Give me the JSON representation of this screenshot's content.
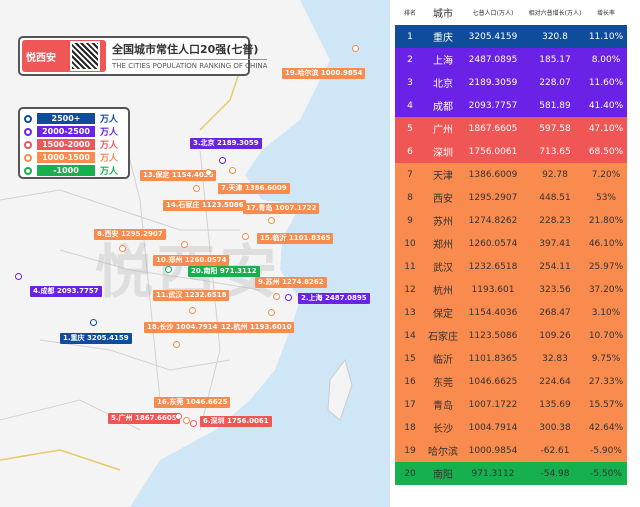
{
  "title": {
    "brand": "悦西安",
    "cn": "全国城市常住人口20强(七普)",
    "en": "THE CITIES POPULATION RANKING OF CHINA"
  },
  "watermark": "悦西安",
  "legend": [
    {
      "range": "2500+",
      "unit": "万人",
      "color": "#0f4c9c"
    },
    {
      "range": "2000-2500",
      "unit": "万人",
      "color": "#6a22e6"
    },
    {
      "range": "1500-2000",
      "unit": "万人",
      "color": "#f05656"
    },
    {
      "range": "1000-1500",
      "unit": "万人",
      "color": "#f98b4e"
    },
    {
      "range": "-1000",
      "unit": "万人",
      "color": "#17b04e"
    }
  ],
  "map_labels": [
    {
      "text": "19.哈尔滨 1000.9854",
      "tier": 3
    },
    {
      "text": "3.北京 2189.3059",
      "tier": 1
    },
    {
      "text": "13.保定 1154.4036",
      "tier": 3
    },
    {
      "text": "7.天津 1386.6009",
      "tier": 3
    },
    {
      "text": "14.石家庄 1123.5086",
      "tier": 3
    },
    {
      "text": "17.青岛 1007.1722",
      "tier": 3
    },
    {
      "text": "8.西安 1295.2907",
      "tier": 3
    },
    {
      "text": "15.临沂 1101.8365",
      "tier": 3
    },
    {
      "text": "10.郑州 1260.0574",
      "tier": 3
    },
    {
      "text": "20.南阳 971.3112",
      "tier": 4
    },
    {
      "text": "9.苏州 1274.8262",
      "tier": 3
    },
    {
      "text": "4.成都 2093.7757",
      "tier": 1
    },
    {
      "text": "2.上海 2487.0895",
      "tier": 1
    },
    {
      "text": "11.武汉 1232.6518",
      "tier": 3
    },
    {
      "text": "18.长沙 1004.7914",
      "tier": 3
    },
    {
      "text": "12.杭州 1193.6010",
      "tier": 3
    },
    {
      "text": "1.重庆 3205.4159",
      "tier": 0
    },
    {
      "text": "16.东莞 1046.6625",
      "tier": 3
    },
    {
      "text": "5.广州 1867.6605",
      "tier": 2
    },
    {
      "text": "6.深圳 1756.0061",
      "tier": 2
    }
  ],
  "chart_data": {
    "type": "table",
    "title": "全国城市常住人口20强(七普)",
    "columns": [
      "排名",
      "城市",
      "七普人口(万人)",
      "相对六普增长(万人)",
      "增长率"
    ],
    "rows": [
      [
        "1",
        "重庆",
        "3205.4159",
        "320.8",
        "11.10%"
      ],
      [
        "2",
        "上海",
        "2487.0895",
        "185.17",
        "8.00%"
      ],
      [
        "3",
        "北京",
        "2189.3059",
        "228.07",
        "11.60%"
      ],
      [
        "4",
        "成都",
        "2093.7757",
        "581.89",
        "41.40%"
      ],
      [
        "5",
        "广州",
        "1867.6605",
        "597.58",
        "47.10%"
      ],
      [
        "6",
        "深圳",
        "1756.0061",
        "713.65",
        "68.50%"
      ],
      [
        "7",
        "天津",
        "1386.6009",
        "92.78",
        "7.20%"
      ],
      [
        "8",
        "西安",
        "1295.2907",
        "448.51",
        "53%"
      ],
      [
        "9",
        "苏州",
        "1274.8262",
        "228.23",
        "21.80%"
      ],
      [
        "10",
        "郑州",
        "1260.0574",
        "397.41",
        "46.10%"
      ],
      [
        "11",
        "武汉",
        "1232.6518",
        "254.11",
        "25.97%"
      ],
      [
        "12",
        "杭州",
        "1193.601",
        "323.56",
        "37.20%"
      ],
      [
        "13",
        "保定",
        "1154.4036",
        "268.47",
        "3.10%"
      ],
      [
        "14",
        "石家庄",
        "1123.5086",
        "109.26",
        "10.70%"
      ],
      [
        "15",
        "临沂",
        "1101.8365",
        "32.83",
        "9.75%"
      ],
      [
        "16",
        "东莞",
        "1046.6625",
        "224.64",
        "27.33%"
      ],
      [
        "17",
        "青岛",
        "1007.1722",
        "135.69",
        "15.57%"
      ],
      [
        "18",
        "长沙",
        "1004.7914",
        "300.38",
        "42.64%"
      ],
      [
        "19",
        "哈尔滨",
        "1000.9854",
        "-62.61",
        "-5.90%"
      ],
      [
        "20",
        "南阳",
        "971.3112",
        "-54.98",
        "-5.50%"
      ]
    ],
    "row_tiers": [
      0,
      1,
      1,
      1,
      2,
      2,
      3,
      3,
      3,
      3,
      3,
      3,
      3,
      3,
      3,
      3,
      3,
      3,
      3,
      4
    ]
  }
}
